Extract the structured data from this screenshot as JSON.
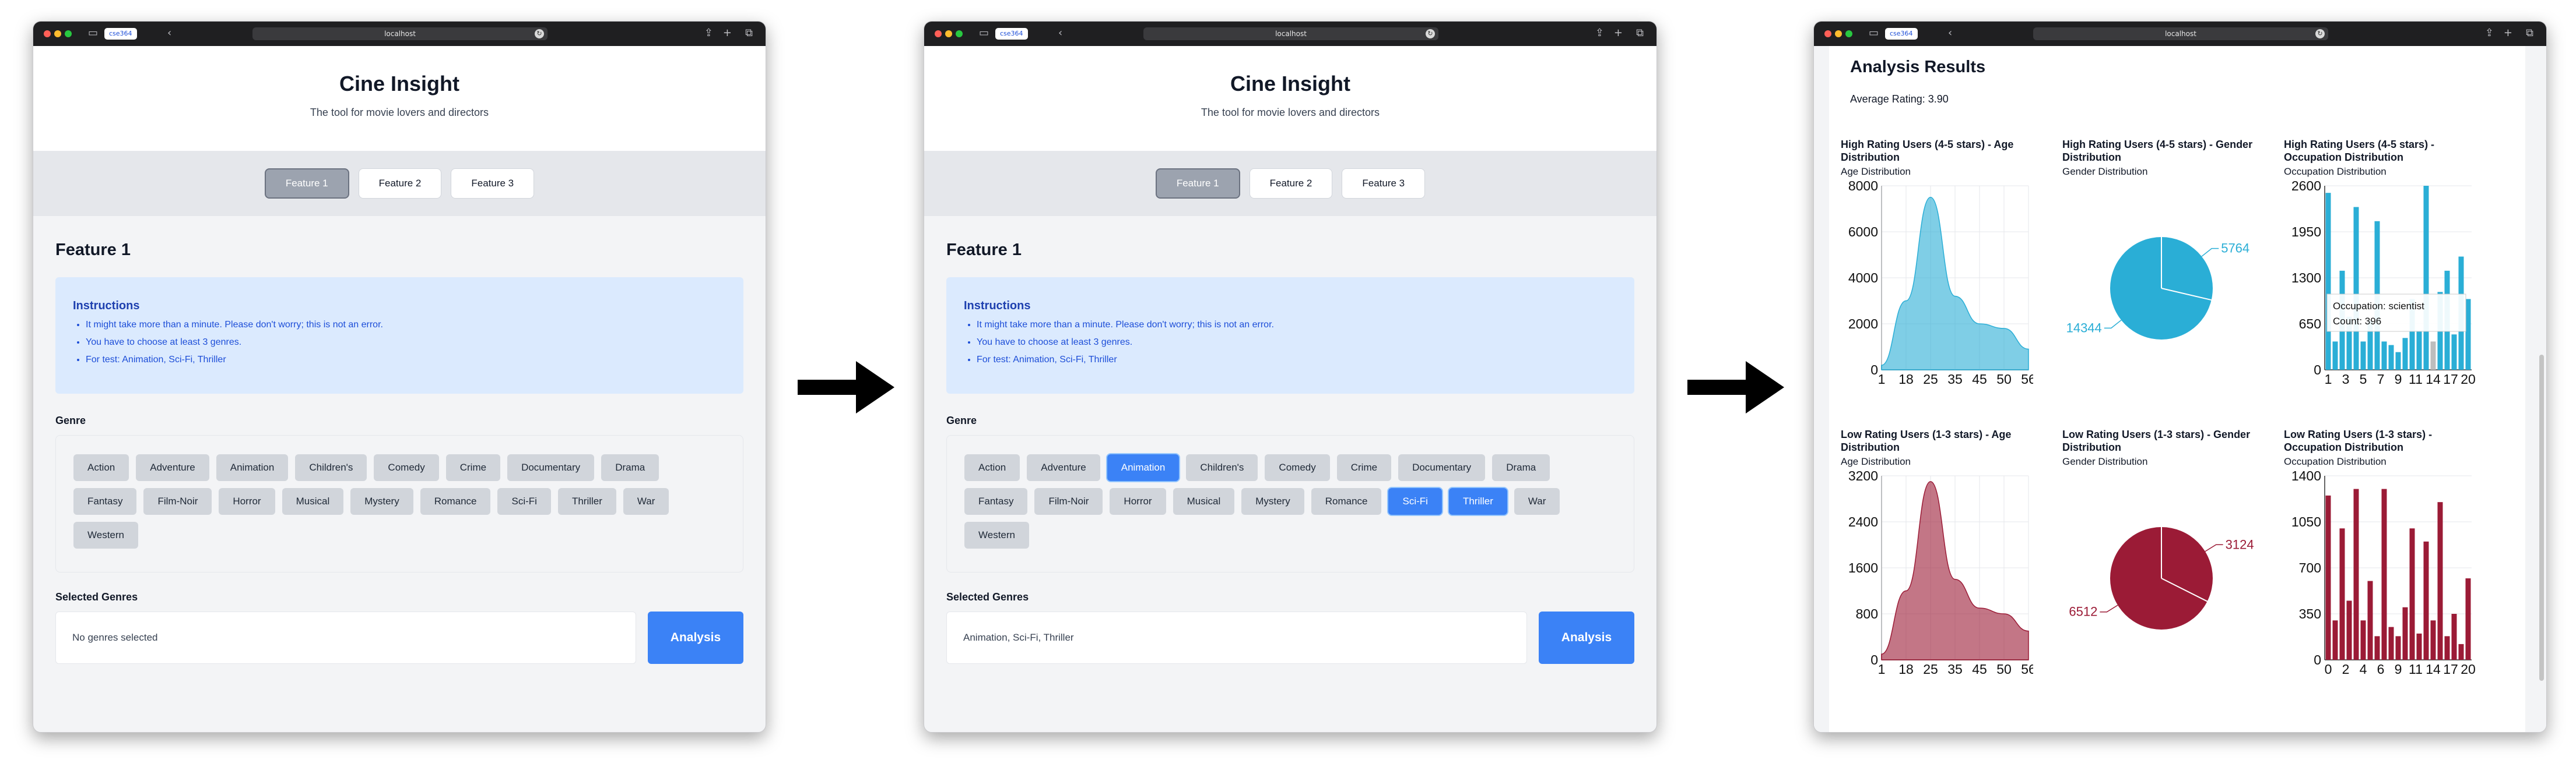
{
  "browser": {
    "tab_label": "cse364",
    "address": "localhost"
  },
  "app": {
    "title": "Cine Insight",
    "subtitle": "The tool for movie lovers and directors"
  },
  "features": [
    "Feature 1",
    "Feature 2",
    "Feature 3"
  ],
  "feature_title": "Feature 1",
  "instructions": {
    "heading": "Instructions",
    "items": [
      "It might take more than a minute. Please don't worry; this is not an error.",
      "You have to choose at least 3 genres.",
      "For test: Animation, Sci-Fi, Thriller"
    ]
  },
  "genre_label": "Genre",
  "genres": [
    "Action",
    "Adventure",
    "Animation",
    "Children's",
    "Comedy",
    "Crime",
    "Documentary",
    "Drama",
    "Fantasy",
    "Film-Noir",
    "Horror",
    "Musical",
    "Mystery",
    "Romance",
    "Sci-Fi",
    "Thriller",
    "War",
    "Western"
  ],
  "selected_label": "Selected Genres",
  "analysis_label": "Analysis",
  "screen1": {
    "selected_text": "No genres selected",
    "selected": []
  },
  "screen2": {
    "selected_text": "Animation, Sci-Fi, Thriller",
    "selected": [
      "Animation",
      "Sci-Fi",
      "Thriller"
    ]
  },
  "results": {
    "title": "Analysis Results",
    "average": "Average Rating: 3.90",
    "tooltip": {
      "line1": "Occupation: scientist",
      "line2": "Count: 396"
    },
    "colors": {
      "high": "#2aaed6",
      "low": "#9b1b36"
    }
  },
  "chart_data": [
    {
      "type": "area",
      "title": "High Rating Users (4-5 stars) - Age Distribution",
      "subtitle": "Age Distribution",
      "x_ticks": [
        "1",
        "18",
        "25",
        "35",
        "45",
        "50",
        "56"
      ],
      "y_ticks": [
        "0",
        "2000",
        "4000",
        "6000",
        "8000"
      ],
      "ylim": [
        0,
        8000
      ],
      "x": [
        1,
        18,
        25,
        35,
        45,
        50,
        56
      ],
      "values": [
        200,
        3000,
        7500,
        3200,
        2000,
        1800,
        900
      ]
    },
    {
      "type": "pie",
      "title": "High Rating Users (4-5 stars) - Gender Distribution",
      "subtitle": "Gender Distribution",
      "labels": [
        "5764",
        "14344"
      ],
      "values": [
        5764,
        14344
      ]
    },
    {
      "type": "bar",
      "title": "High Rating Users (4-5 stars) - Occupation Distribution",
      "subtitle": "Occupation Distribution",
      "x_ticks": [
        "1",
        "3",
        "5",
        "7",
        "9",
        "11",
        "14",
        "17",
        "20"
      ],
      "y_ticks": [
        "0",
        "650",
        "1300",
        "1950",
        "2600"
      ],
      "ylim": [
        0,
        2600
      ],
      "categories": [
        0,
        1,
        2,
        3,
        4,
        5,
        6,
        7,
        8,
        9,
        10,
        11,
        12,
        13,
        14,
        15,
        16,
        17,
        18,
        19,
        20
      ],
      "values": [
        2500,
        400,
        1400,
        750,
        2300,
        400,
        700,
        2100,
        400,
        350,
        250,
        450,
        1000,
        550,
        2600,
        400,
        1100,
        1400,
        500,
        1600,
        1000
      ],
      "highlight": 15
    },
    {
      "type": "area",
      "title": "Low Rating Users (1-3 stars) - Age Distribution",
      "subtitle": "Age Distribution",
      "x_ticks": [
        "1",
        "18",
        "25",
        "35",
        "45",
        "50",
        "56"
      ],
      "y_ticks": [
        "0",
        "800",
        "1600",
        "2400",
        "3200"
      ],
      "ylim": [
        0,
        3200
      ],
      "x": [
        1,
        18,
        25,
        35,
        45,
        50,
        56
      ],
      "values": [
        100,
        1200,
        3100,
        1400,
        900,
        800,
        500
      ]
    },
    {
      "type": "pie",
      "title": "Low Rating Users (1-3 stars) - Gender Distribution",
      "subtitle": "Gender Distribution",
      "labels": [
        "3124",
        "6512"
      ],
      "values": [
        3124,
        6512
      ]
    },
    {
      "type": "bar",
      "title": "Low Rating Users (1-3 stars) - Occupation Distribution",
      "subtitle": "Occupation Distribution",
      "x_ticks": [
        "0",
        "2",
        "4",
        "6",
        "9",
        "11",
        "14",
        "17",
        "20"
      ],
      "y_ticks": [
        "0",
        "350",
        "700",
        "1050",
        "1400"
      ],
      "ylim": [
        0,
        1400
      ],
      "categories": [
        0,
        1,
        2,
        3,
        4,
        5,
        6,
        7,
        8,
        9,
        10,
        11,
        12,
        13,
        14,
        15,
        16,
        17,
        18,
        19,
        20
      ],
      "values": [
        1250,
        300,
        1000,
        450,
        1300,
        300,
        600,
        180,
        1300,
        250,
        180,
        400,
        1000,
        200,
        900,
        300,
        1200,
        180,
        350,
        120,
        620
      ]
    }
  ]
}
